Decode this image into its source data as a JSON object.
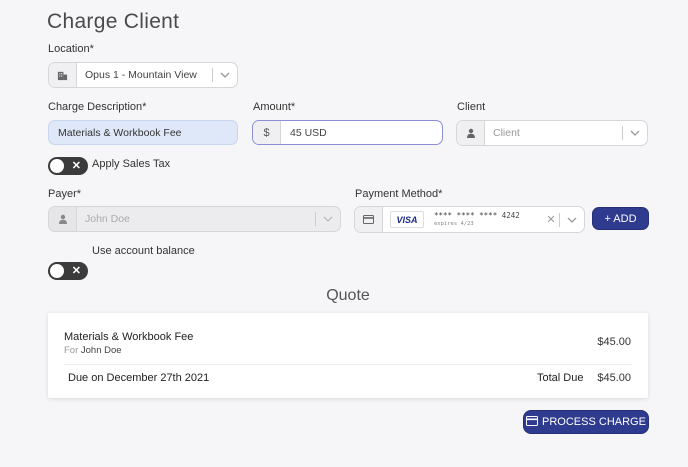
{
  "page": {
    "title": "Charge Client"
  },
  "location": {
    "label": "Location*",
    "value": "Opus 1 - Mountain View",
    "icon": "building-icon"
  },
  "charge_description": {
    "label": "Charge Description*",
    "value": "Materials & Workbook Fee"
  },
  "amount": {
    "label": "Amount*",
    "prefix": "$",
    "value": "45 USD"
  },
  "client": {
    "label": "Client",
    "placeholder": "Client",
    "icon": "user-icon"
  },
  "sales_tax": {
    "label": "Apply Sales Tax",
    "on": false
  },
  "payer": {
    "label": "Payer*",
    "value": "John Doe",
    "icon": "user-icon"
  },
  "payment_method": {
    "label": "Payment Method*",
    "brand": "VISA",
    "number": "**** **** **** 4242",
    "expires": "expires 4/23",
    "add_label": "+ ADD"
  },
  "account_balance": {
    "label": "Use account balance",
    "on": false
  },
  "quote": {
    "heading": "Quote",
    "item_name": "Materials & Workbook Fee",
    "item_for_prefix": "For",
    "item_for_name": "John Doe",
    "item_price": "$45.00",
    "due_text": "Due on December 27th 2021",
    "total_label": "Total Due",
    "total_value": "$45.00"
  },
  "process_button": {
    "label": "PROCESS CHARGE"
  },
  "colors": {
    "accent": "#2f3b8f",
    "input_highlight": "#dfe8f8",
    "background": "#f6f6f8"
  }
}
